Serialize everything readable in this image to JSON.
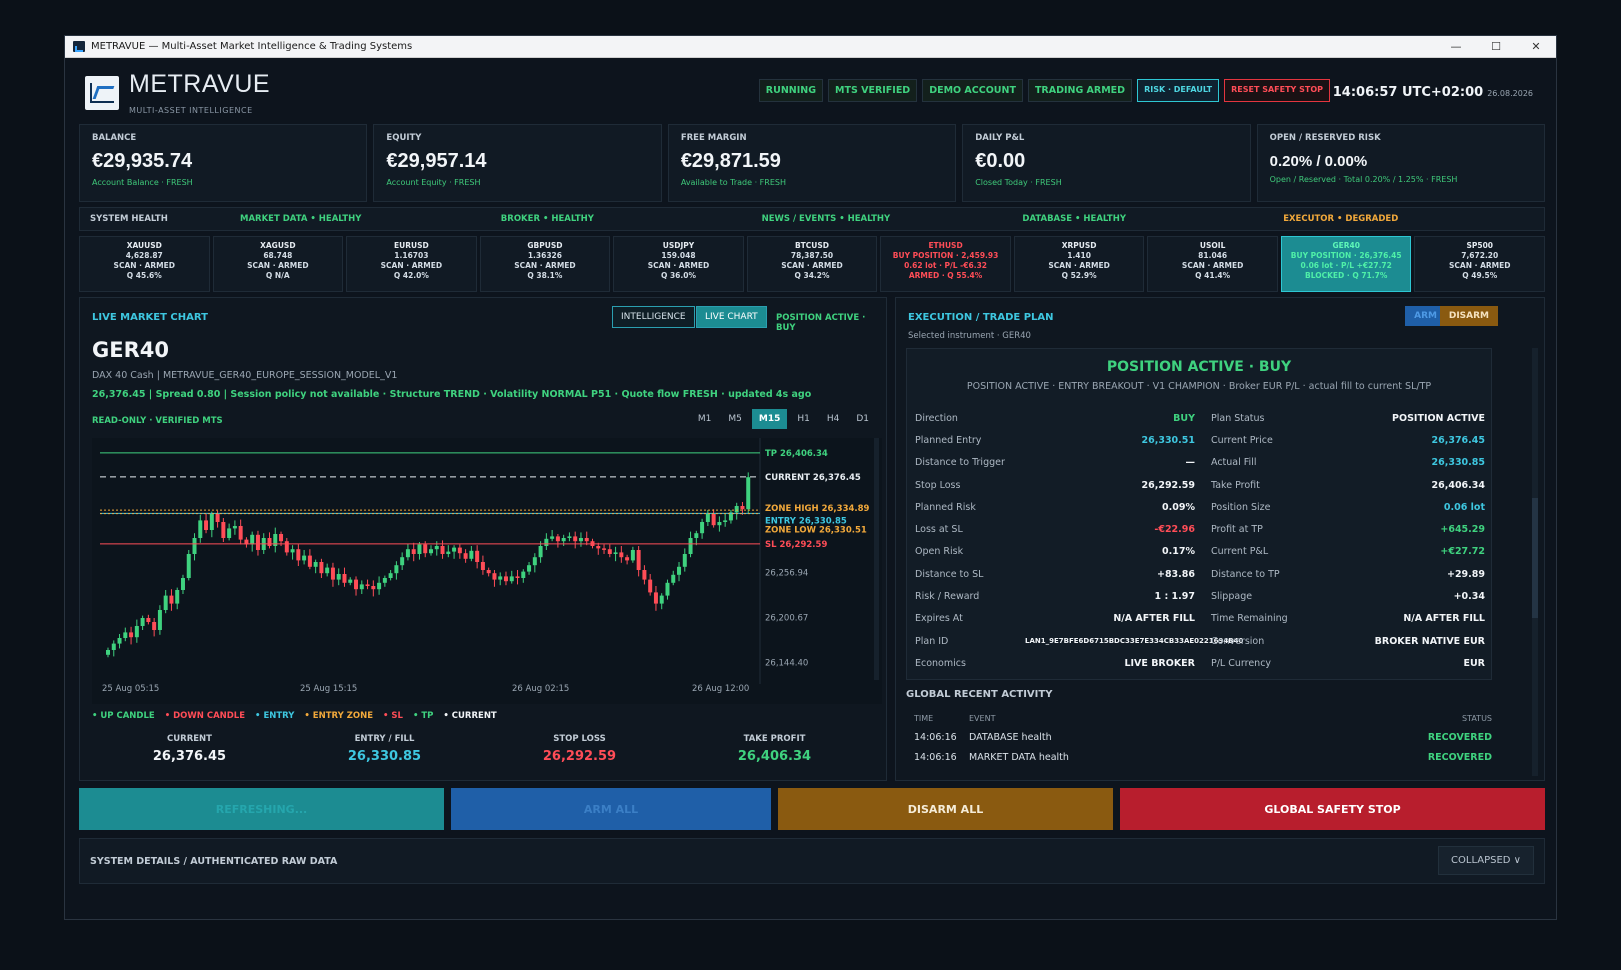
{
  "window": {
    "title": "METRAVUE — Multi-Asset Market Intelligence & Trading Systems",
    "min": "—",
    "max": "☐",
    "close": "✕"
  },
  "header": {
    "brand": "METRAVUE",
    "subtitle": "MULTI-ASSET INTELLIGENCE",
    "pills": [
      "RUNNING",
      "MTS VERIFIED",
      "DEMO ACCOUNT",
      "TRADING ARMED"
    ],
    "risk_btn": "RISK · DEFAULT",
    "reset_btn": "RESET SAFETY STOP",
    "time": "14:06:57 UTC+02:00",
    "date": "26.08.2026"
  },
  "cards": [
    {
      "label": "BALANCE",
      "value": "€29,935.74",
      "sub": "Account Balance · FRESH"
    },
    {
      "label": "EQUITY",
      "value": "€29,957.14",
      "sub": "Account Equity · FRESH"
    },
    {
      "label": "FREE MARGIN",
      "value": "€29,871.59",
      "sub": "Available to Trade · FRESH"
    },
    {
      "label": "DAILY P&L",
      "value": "€0.00",
      "sub": "Closed Today · FRESH"
    },
    {
      "label": "OPEN / RESERVED RISK",
      "value": "0.20% / 0.00%",
      "sub": "Open / Reserved · Total 0.20% / 1.25% · FRESH"
    }
  ],
  "health": {
    "title": "SYSTEM HEALTH",
    "items": [
      "MARKET DATA • HEALTHY",
      "BROKER • HEALTHY",
      "NEWS / EVENTS • HEALTHY",
      "DATABASE • HEALTHY",
      "EXECUTOR • DEGRADED"
    ]
  },
  "tickers": [
    {
      "sym": "XAUUSD",
      "l1": "4,628.87",
      "l2": "SCAN · ARMED",
      "l3": "Q 45.6%"
    },
    {
      "sym": "XAGUSD",
      "l1": "68.748",
      "l2": "SCAN · ARMED",
      "l3": "Q N/A"
    },
    {
      "sym": "EURUSD",
      "l1": "1.16703",
      "l2": "SCAN · ARMED",
      "l3": "Q 42.0%"
    },
    {
      "sym": "GBPUSD",
      "l1": "1.36326",
      "l2": "SCAN · ARMED",
      "l3": "Q 38.1%"
    },
    {
      "sym": "USDJPY",
      "l1": "159.048",
      "l2": "SCAN · ARMED",
      "l3": "Q 36.0%"
    },
    {
      "sym": "BTCUSD",
      "l1": "78,387.50",
      "l2": "SCAN · ARMED",
      "l3": "Q 34.2%"
    },
    {
      "sym": "ETHUSD",
      "l1": "BUY POSITION · 2,459.93",
      "l2": "0.62 lot · P/L -€6.32",
      "l3": "ARMED · Q 55.4%"
    },
    {
      "sym": "XRPUSD",
      "l1": "1.410",
      "l2": "SCAN · ARMED",
      "l3": "Q 52.9%"
    },
    {
      "sym": "USOIL",
      "l1": "81.046",
      "l2": "SCAN · ARMED",
      "l3": "Q 41.4%"
    },
    {
      "sym": "GER40",
      "l1": "BUY POSITION · 26,376.45",
      "l2": "0.06 lot · P/L +€27.72",
      "l3": "BLOCKED · Q 71.7%"
    },
    {
      "sym": "SP500",
      "l1": "7,672.20",
      "l2": "SCAN · ARMED",
      "l3": "Q 49.5%"
    }
  ],
  "chart_panel": {
    "title": "LIVE MARKET CHART",
    "tab_intel": "INTELLIGENCE",
    "tab_live": "LIVE CHART",
    "pos_active": "POSITION ACTIVE · BUY",
    "symbol": "GER40",
    "desc": "DAX 40 Cash  |  METRAVUE_GER40_EUROPE_SESSION_MODEL_V1",
    "meta": "26,376.45  |  Spread 0.80  |  Session policy not available  ·  Structure TREND  ·  Volatility NORMAL P51  ·  Quote flow FRESH  ·  updated 4s ago",
    "readonly": "READ-ONLY · VERIFIED MTS",
    "timeframes": [
      "M1",
      "M5",
      "M15",
      "H1",
      "H4",
      "D1"
    ],
    "legend": [
      {
        "t": "• UP CANDLE",
        "c": "#3fd27f"
      },
      {
        "t": "• DOWN CANDLE",
        "c": "#ff4d57"
      },
      {
        "t": "• ENTRY",
        "c": "#3ec7e0"
      },
      {
        "t": "• ENTRY ZONE",
        "c": "#f2a93b"
      },
      {
        "t": "• SL",
        "c": "#ff4d57"
      },
      {
        "t": "• TP",
        "c": "#3fd27f"
      },
      {
        "t": "• CURRENT",
        "c": "#f2f5f8"
      }
    ],
    "summary": [
      {
        "l": "CURRENT",
        "v": "26,376.45"
      },
      {
        "l": "ENTRY / FILL",
        "v": "26,330.85"
      },
      {
        "l": "STOP LOSS",
        "v": "26,292.59"
      },
      {
        "l": "TAKE PROFIT",
        "v": "26,406.34"
      }
    ]
  },
  "chart_data": {
    "type": "candlestick",
    "x_ticks": [
      "25 Aug 05:15",
      "25 Aug 15:15",
      "26 Aug 02:15",
      "26 Aug 12:00"
    ],
    "y_ticks": [
      "26,256.94",
      "26,200.67",
      "26,144.40"
    ],
    "ylim": [
      26130,
      26420
    ],
    "levels": [
      {
        "name": "TP",
        "label": "TP 26,406.34",
        "value": 26406.34,
        "color": "#3fd27f"
      },
      {
        "name": "CURRENT",
        "label": "CURRENT 26,376.45",
        "value": 26376.45,
        "color": "#e8edf2"
      },
      {
        "name": "ZONE HIGH",
        "label": "ZONE HIGH 26,334.89",
        "value": 26334.89,
        "color": "#f2a93b"
      },
      {
        "name": "ENTRY",
        "label": "ENTRY 26,330.85",
        "value": 26330.85,
        "color": "#3ec7e0"
      },
      {
        "name": "ZONE LOW",
        "label": "ZONE LOW 26,330.51",
        "value": 26330.51,
        "color": "#f2a93b"
      },
      {
        "name": "SL",
        "label": "SL 26,292.59",
        "value": 26292.59,
        "color": "#ff4d57"
      }
    ],
    "close": [
      26160,
      26168,
      26175,
      26182,
      26176,
      26190,
      26200,
      26195,
      26185,
      26210,
      26228,
      26218,
      26235,
      26250,
      26280,
      26300,
      26322,
      26310,
      26330,
      26320,
      26300,
      26312,
      26315,
      26298,
      26292,
      26304,
      26285,
      26300,
      26290,
      26305,
      26296,
      26282,
      26286,
      26272,
      26278,
      26264,
      26270,
      26256,
      26263,
      26248,
      26255,
      26244,
      26248,
      26236,
      26242,
      26240,
      26236,
      26244,
      26250,
      26256,
      26266,
      26276,
      26286,
      26280,
      26292,
      26281,
      26286,
      26290,
      26280,
      26283,
      26288,
      26281,
      26274,
      26284,
      26270,
      26260,
      26256,
      26248,
      26252,
      26246,
      26252,
      26250,
      26258,
      26266,
      26276,
      26290,
      26299,
      26302,
      26296,
      26300,
      26302,
      26296,
      26300,
      26296,
      26290,
      26287,
      26286,
      26280,
      26282,
      26276,
      26272,
      26285,
      26260,
      26248,
      26232,
      26218,
      26228,
      26244,
      26254,
      26264,
      26280,
      26300,
      26306,
      26320,
      26330,
      26316,
      26320,
      26322,
      26332,
      26340,
      26336,
      26376
    ]
  },
  "exec": {
    "title": "EXECUTION / TRADE PLAN",
    "arm": "ARM",
    "disarm": "DISARM",
    "selected": "Selected instrument · GER40",
    "banner": "POSITION ACTIVE  ·  BUY",
    "banner_sub": "POSITION ACTIVE  ·  ENTRY BREAKOUT  ·  V1 CHAMPION  ·  Broker EUR P/L · actual fill to current SL/TP",
    "rows": [
      {
        "k": "Direction",
        "v": "BUY",
        "vc": "g",
        "k2": "Plan Status",
        "v2": "POSITION ACTIVE",
        "v2c": "w"
      },
      {
        "k": "Planned Entry",
        "v": "26,330.51",
        "vc": "b",
        "k2": "Current Price",
        "v2": "26,376.45",
        "v2c": "b"
      },
      {
        "k": "Distance to Trigger",
        "v": "—",
        "vc": "w",
        "k2": "Actual Fill",
        "v2": "26,330.85",
        "v2c": "b"
      },
      {
        "k": "Stop Loss",
        "v": "26,292.59",
        "vc": "w",
        "k2": "Take Profit",
        "v2": "26,406.34",
        "v2c": "w"
      },
      {
        "k": "Planned Risk",
        "v": "0.09%",
        "vc": "w",
        "k2": "Position Size",
        "v2": "0.06 lot",
        "v2c": "b"
      },
      {
        "k": "Loss at SL",
        "v": "-€22.96",
        "vc": "r",
        "k2": "Profit at TP",
        "v2": "+645.29",
        "v2c": "g"
      },
      {
        "k": "Open Risk",
        "v": "0.17%",
        "vc": "w",
        "k2": "Current P&L",
        "v2": "+€27.72",
        "v2c": "g"
      },
      {
        "k": "Distance to SL",
        "v": "+83.86",
        "vc": "w",
        "k2": "Distance to TP",
        "v2": "+29.89",
        "v2c": "w"
      },
      {
        "k": "Risk / Reward",
        "v": "1 : 1.97",
        "vc": "w",
        "k2": "Slippage",
        "v2": "+0.34",
        "v2c": "w"
      },
      {
        "k": "Expires At",
        "v": "N/A AFTER FILL",
        "vc": "w",
        "k2": "Time Remaining",
        "v2": "N/A AFTER FILL",
        "v2c": "w"
      },
      {
        "k": "Plan ID",
        "v": "LAN1_9E7BFE6D6715BDC33E7E334CB33AE0221694B40",
        "vc": "w",
        "k2": "Conversion",
        "v2": "BROKER NATIVE EUR",
        "v2c": "w"
      },
      {
        "k": "Economics",
        "v": "LIVE BROKER",
        "vc": "w",
        "k2": "P/L Currency",
        "v2": "EUR",
        "v2c": "w"
      }
    ],
    "recent_title": "GLOBAL RECENT ACTIVITY",
    "recent_head": {
      "time": "TIME",
      "event": "EVENT",
      "status": "STATUS"
    },
    "recent": [
      {
        "time": "14:06:16",
        "event": "DATABASE health",
        "status": "RECOVERED"
      },
      {
        "time": "14:06:16",
        "event": "MARKET DATA health",
        "status": "RECOVERED"
      }
    ]
  },
  "actions": {
    "refresh": "REFRESHING...",
    "arm_all": "ARM ALL",
    "disarm_all": "DISARM ALL",
    "safety": "GLOBAL SAFETY STOP"
  },
  "details": {
    "title": "SYSTEM DETAILS / AUTHENTICATED RAW DATA",
    "collapsed": "COLLAPSED  ∨"
  }
}
